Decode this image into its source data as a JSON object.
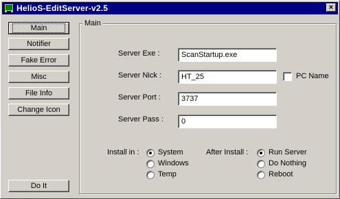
{
  "window": {
    "title": "HelioS-EditServer-v2.5",
    "close_glyph": "×"
  },
  "sidebar": {
    "buttons": [
      {
        "label": "Main"
      },
      {
        "label": "Notifier"
      },
      {
        "label": "Fake Error"
      },
      {
        "label": "Misc"
      },
      {
        "label": "File Info"
      },
      {
        "label": "Change Icon"
      }
    ],
    "do_it": "Do It"
  },
  "main": {
    "group_title": "Main",
    "server_exe": {
      "label": "Server Exe :",
      "value": "ScanStartup.exe"
    },
    "server_nick": {
      "label": "Server Nick :",
      "value": "HT_25"
    },
    "pc_name": {
      "label": "PC Name",
      "checked": false
    },
    "server_port": {
      "label": "Server Port :",
      "value": "3737"
    },
    "server_pass": {
      "label": "Server Pass :",
      "value": "0"
    },
    "install_in": {
      "label": "Install in :",
      "options": [
        "System",
        "Windows",
        "Temp"
      ],
      "selected": "System"
    },
    "after_install": {
      "label": "After Install :",
      "options": [
        "Run Server",
        "Do Nothing",
        "Reboot"
      ],
      "selected": "Run Server"
    }
  },
  "colors": {
    "face": "#d4d0c8",
    "titlebar": "#000080"
  }
}
